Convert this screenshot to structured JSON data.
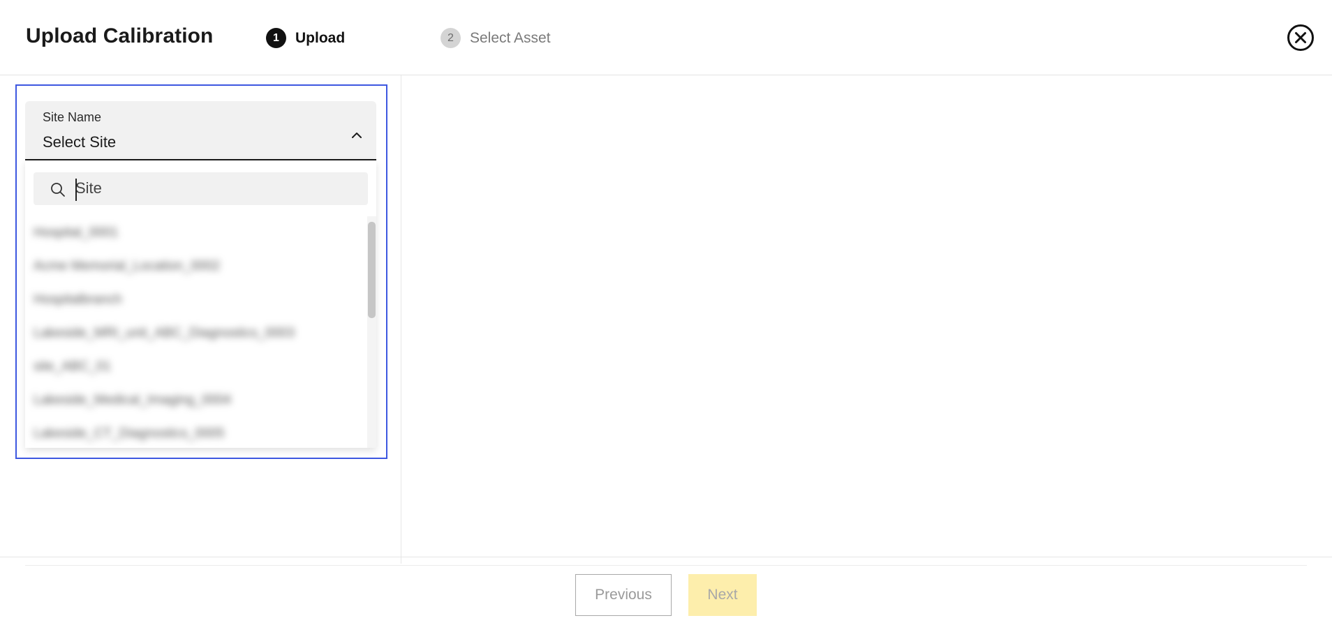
{
  "header": {
    "title": "Upload Calibration",
    "steps": [
      {
        "number": "1",
        "label": "Upload",
        "state": "active"
      },
      {
        "number": "2",
        "label": "Select Asset",
        "state": "inactive"
      }
    ],
    "close_icon": "close-circle-icon"
  },
  "site_select": {
    "label": "Site Name",
    "value": "Select Site",
    "expanded": true,
    "search": {
      "placeholder": "Site",
      "value": ""
    },
    "options": [
      "Hospital_0001",
      "Acme Memorial_Location_0002",
      "Hospitalbranch",
      "Lakeside_MRI_unit_ABC_Diagnostics_0003",
      "site_ABC_01",
      "Lakeside_Medical_Imaging_0004",
      "Lakeside_CT_Diagnostics_0005"
    ],
    "options_obscured": true
  },
  "footer": {
    "previous_label": "Previous",
    "next_label": "Next"
  },
  "colors": {
    "focus_outline": "#3d57e0",
    "next_button_bg": "#fdeeac",
    "active_step_bg": "#111111",
    "inactive_step_bg": "#d4d4d4"
  }
}
